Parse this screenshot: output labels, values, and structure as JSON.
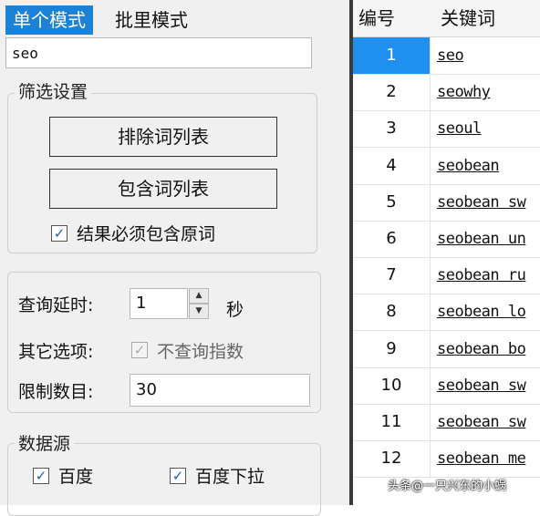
{
  "tabs": {
    "single": "单个模式",
    "batch": "批里模式"
  },
  "seed_input": {
    "value": "seo"
  },
  "filter": {
    "title": "筛选设置",
    "exclude_button": "排除词列表",
    "include_button": "包含词列表",
    "must_contain_label": "结果必须包含原词",
    "must_contain_checked": true
  },
  "query": {
    "delay_label": "查询延时:",
    "delay_value": "1",
    "delay_unit": "秒",
    "other_label": "其它选项:",
    "no_index_label": "不查询指数",
    "no_index_checked": true,
    "limit_label": "限制数目:",
    "limit_value": "30"
  },
  "datasource": {
    "title": "数据源",
    "items": [
      {
        "label": "百度",
        "checked": true
      },
      {
        "label": "百度下拉",
        "checked": true
      }
    ]
  },
  "table": {
    "headers": [
      "编号",
      "关键词"
    ],
    "rows": [
      {
        "num": "1",
        "keyword": "seo",
        "selected": true
      },
      {
        "num": "2",
        "keyword": "seowhy"
      },
      {
        "num": "3",
        "keyword": "seoul"
      },
      {
        "num": "4",
        "keyword": "seobean"
      },
      {
        "num": "5",
        "keyword": "seobean sw"
      },
      {
        "num": "6",
        "keyword": "seobean un"
      },
      {
        "num": "7",
        "keyword": "seobean ru"
      },
      {
        "num": "8",
        "keyword": "seobean lo"
      },
      {
        "num": "9",
        "keyword": "seobean bo"
      },
      {
        "num": "10",
        "keyword": "seobean sw"
      },
      {
        "num": "11",
        "keyword": "seobean sw"
      },
      {
        "num": "12",
        "keyword": "seobean me"
      }
    ]
  },
  "watermark": "头条@一只兴东的小蜗",
  "colors": {
    "active_tab": "#1c82d8",
    "selected_row": "#1f8ff0"
  },
  "icons": [
    "checkbox-check-icon",
    "spin-up-icon",
    "spin-down-icon"
  ]
}
